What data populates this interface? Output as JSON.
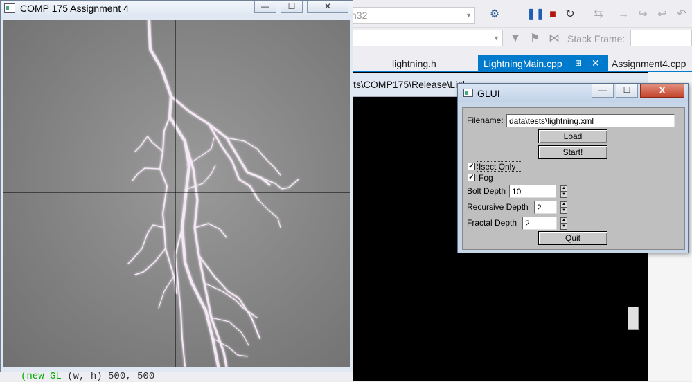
{
  "ide": {
    "config_combo": "n32",
    "stack_frame_label": "Stack Frame:",
    "tabs": [
      "lightning.h",
      "LightningMain.cpp",
      "Assignment4.cpp"
    ],
    "console_path": "ts\\COMP175\\Release\\Lightn",
    "bottom_text_prefix": "(new GL",
    "bottom_text_code": "(w, h)  500, 500"
  },
  "gl_window": {
    "title": "COMP 175 Assignment 4",
    "minimize": "—",
    "maximize": "☐",
    "close": "✕"
  },
  "glui": {
    "title": "GLUI",
    "filename_label": "Filename:",
    "filename_value": "data\\tests\\lightning.xml",
    "load_button": "Load",
    "start_button": "Start!",
    "isect_only_label": "Isect Only",
    "isect_only_checked": "✓",
    "fog_label": "Fog",
    "fog_checked": "✓",
    "bolt_depth_label": "Bolt Depth",
    "bolt_depth_value": "10",
    "recursive_depth_label": "Recursive Depth",
    "recursive_depth_value": "2",
    "fractal_depth_label": "Fractal Depth",
    "fractal_depth_value": "2",
    "quit_button": "Quit",
    "close_glyph": "X"
  },
  "colors": {
    "canvas_bg": "#7c7c7c",
    "lightning": "#f3e6f3",
    "accent_tab": "#007acc"
  }
}
